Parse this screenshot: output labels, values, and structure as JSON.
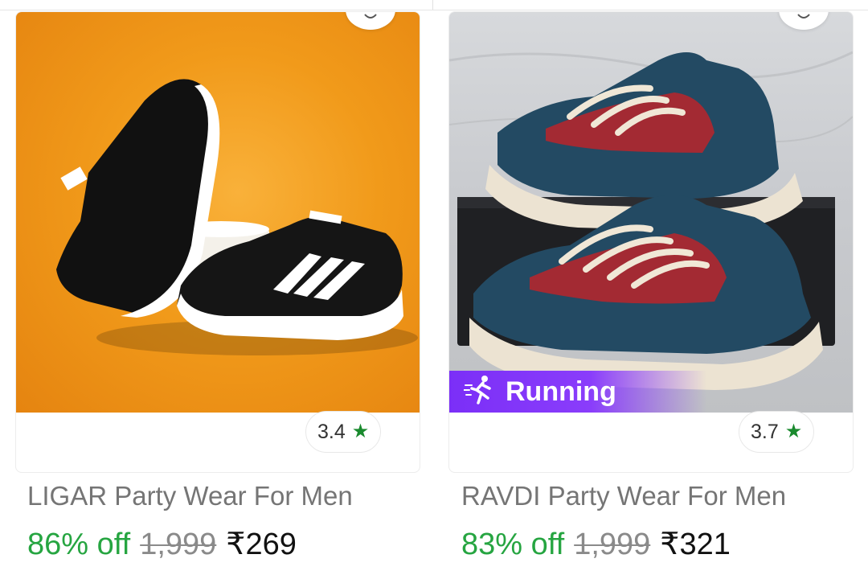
{
  "products": [
    {
      "title": "LIGAR Party Wear For Men",
      "rating": "3.4",
      "discount": "86% off",
      "mrp": "1,999",
      "price": "₹269",
      "badge": ""
    },
    {
      "title": "RAVDI Party Wear For Men",
      "rating": "3.7",
      "discount": "83% off",
      "mrp": "1,999",
      "price": "₹321",
      "badge": "Running"
    }
  ],
  "colors": {
    "discount_green": "#26a541",
    "star_green": "#1a8a2e",
    "badge_purple": "#7b2ff7",
    "left_bg_orange": "#f19a1a"
  },
  "icons": {
    "wishlist": "heart-outline-icon",
    "rating": "star-icon",
    "badge": "runner-icon"
  }
}
